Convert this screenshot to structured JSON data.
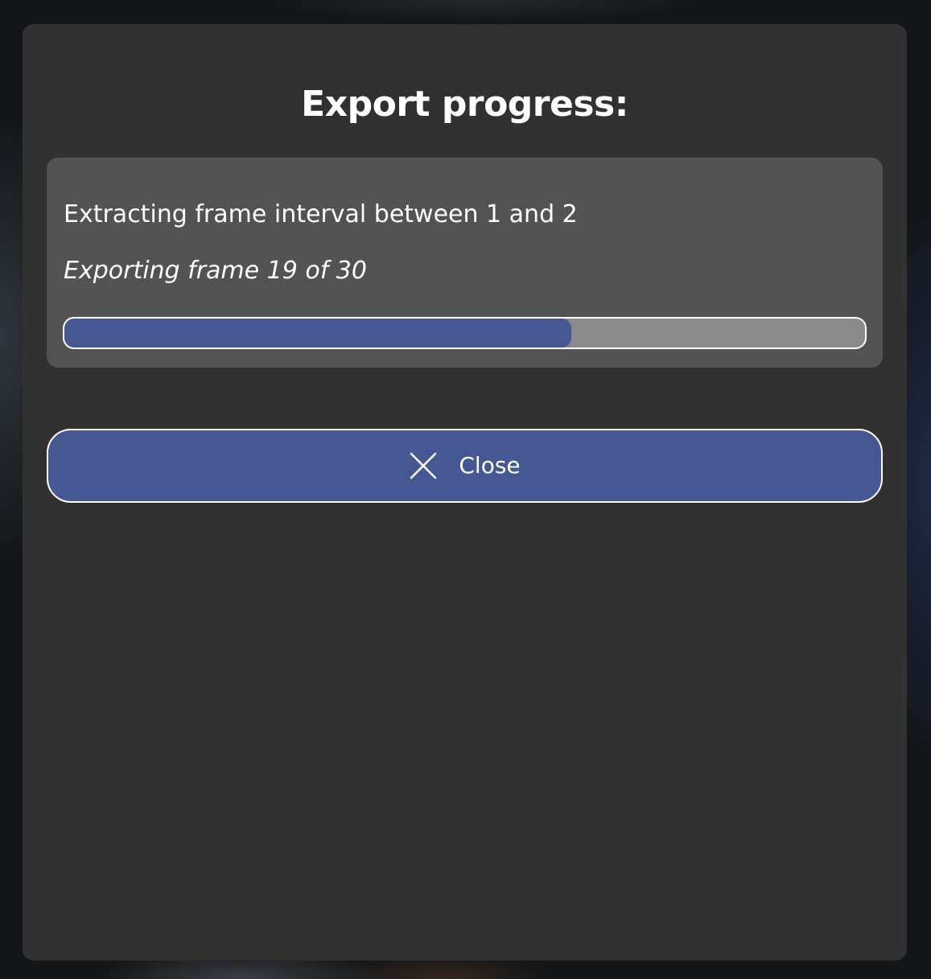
{
  "dialog": {
    "title": "Export progress:",
    "status_line": "Extracting frame interval between 1 and 2",
    "frame_line": "Exporting frame 19 of 30",
    "progress": {
      "current_frame": 19,
      "total_frames": 30,
      "fraction": 0.633
    },
    "close_button": {
      "label": "Close",
      "icon": "close-icon"
    }
  },
  "colors": {
    "modal_background": "#313131",
    "panel_background": "#535353",
    "accent": "#455893",
    "progress_track": "#8a8a8a",
    "text": "#ffffff"
  }
}
